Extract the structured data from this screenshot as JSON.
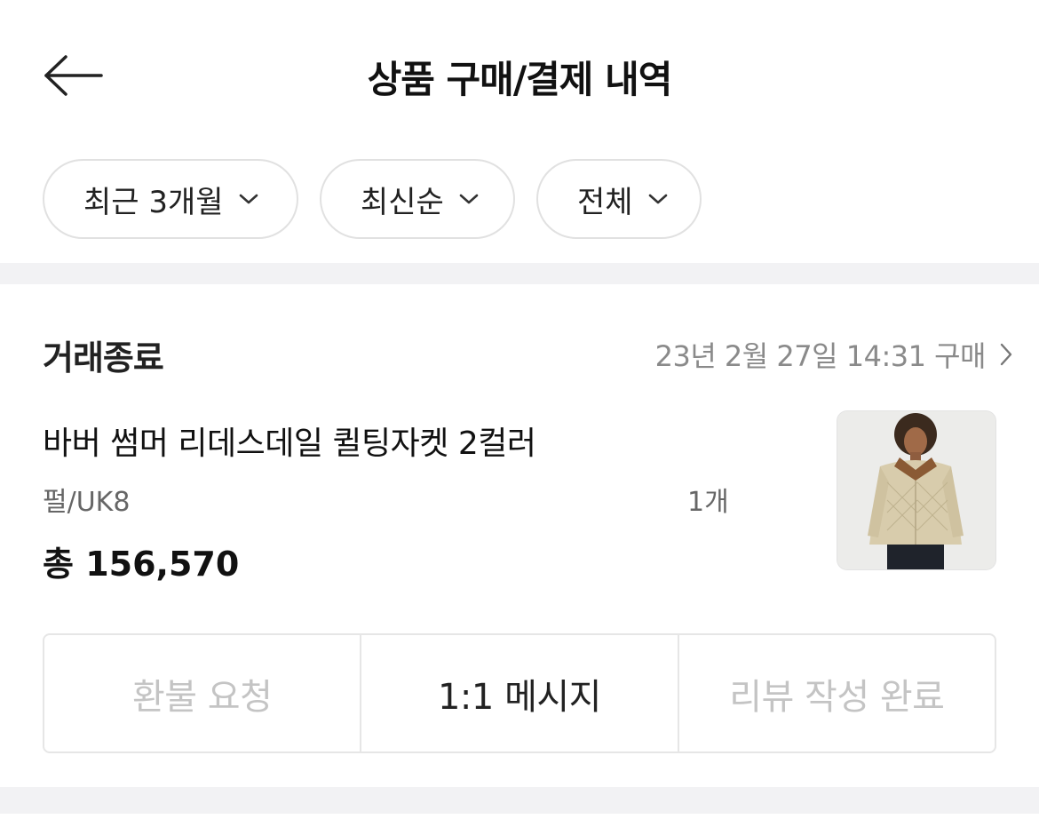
{
  "header": {
    "title": "상품 구매/결제 내역",
    "back_icon": "arrow-left-icon"
  },
  "filters": [
    {
      "label": "최근 3개월",
      "icon": "chevron-down-icon"
    },
    {
      "label": "최신순",
      "icon": "chevron-down-icon"
    },
    {
      "label": "전체",
      "icon": "chevron-down-icon"
    }
  ],
  "order": {
    "status": "거래종료",
    "date_text": "23년 2월 27일 14:31 구매",
    "date_icon": "chevron-right-icon",
    "product_name": "바버 썸머 리데스데일 퀼팅자켓  2컬러",
    "option": "펄/UK8",
    "quantity": "1개",
    "total_prefix": "총",
    "total_amount": "156,570",
    "thumbnail": "product-thumbnail-jacket"
  },
  "actions": [
    {
      "label": "환불 요청",
      "enabled": false
    },
    {
      "label": "1:1 메시지",
      "enabled": true
    },
    {
      "label": "리뷰 작성 완료",
      "enabled": false
    }
  ],
  "colors": {
    "divider_band": "#f2f2f4",
    "muted_text": "#8a8a8a",
    "disabled_text": "#c4c4c4",
    "border": "#e1e1e1"
  }
}
